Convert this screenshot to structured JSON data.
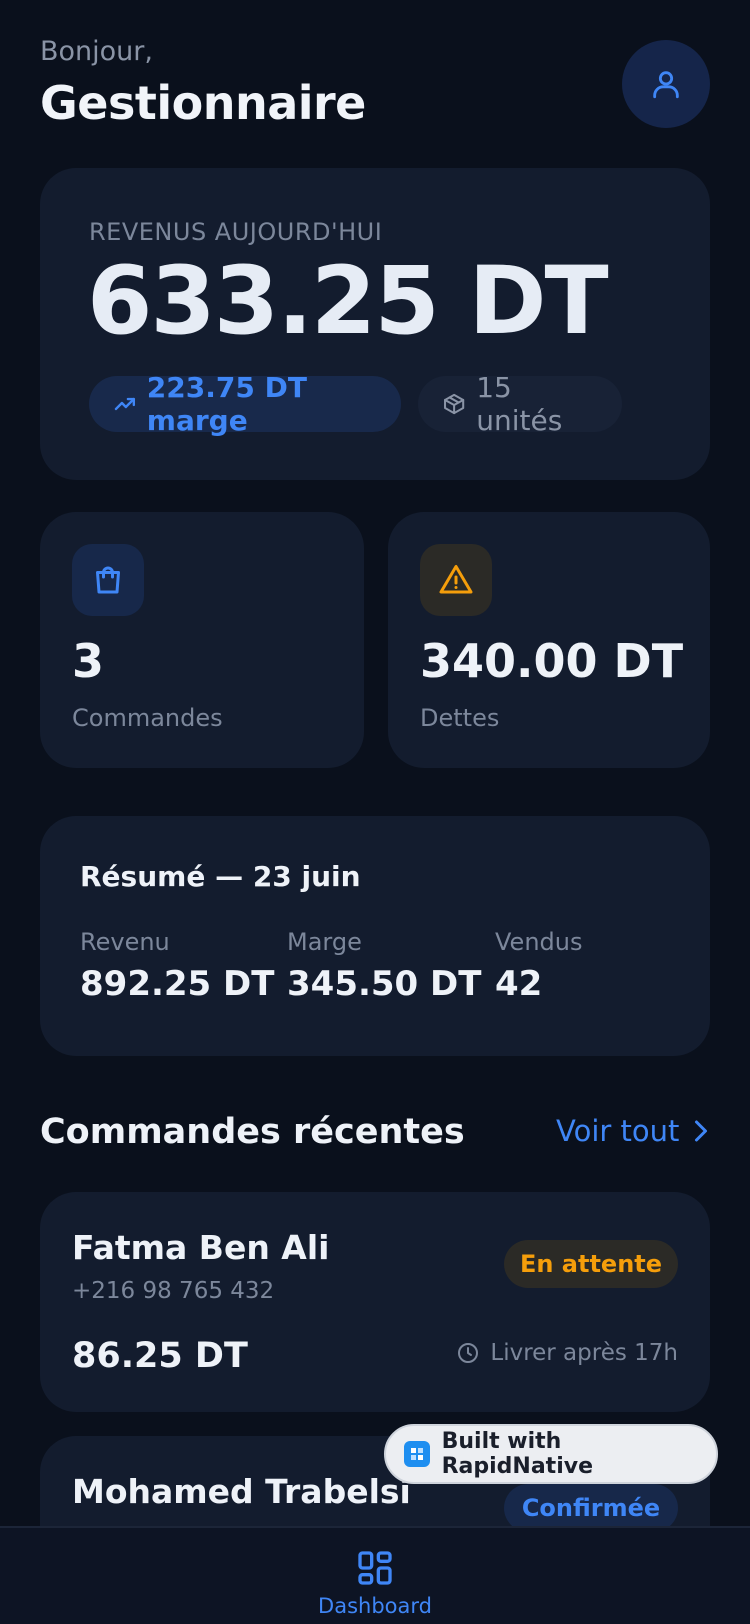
{
  "header": {
    "greeting": "Bonjour,",
    "name": "Gestionnaire",
    "avatar_icon": "user-icon"
  },
  "revenue": {
    "label": "REVENUS AUJOURD'HUI",
    "value": "633.25 DT",
    "margin": "223.75 DT marge",
    "margin_icon": "trending-up-icon",
    "units": "15 unités",
    "units_icon": "package-icon"
  },
  "stats": {
    "orders": {
      "value": "3",
      "label": "Commandes",
      "icon": "shopping-bag-icon"
    },
    "debts": {
      "value": "340.00 DT",
      "label": "Dettes",
      "icon": "alert-triangle-icon"
    }
  },
  "summary": {
    "title": "Résumé — 23 juin",
    "columns": [
      {
        "label": "Revenu",
        "value": "892.25 DT"
      },
      {
        "label": "Marge",
        "value": "345.50 DT"
      },
      {
        "label": "Vendus",
        "value": "42"
      }
    ]
  },
  "recent_orders": {
    "title": "Commandes récentes",
    "see_all": "Voir tout",
    "items": [
      {
        "name": "Fatma Ben Ali",
        "phone": "+216 98 765 432",
        "status": "En attente",
        "amount": "86.25 DT",
        "delivery": "Livrer après 17h"
      },
      {
        "name": "Mohamed Trabelsi",
        "status": "Confirmée"
      }
    ]
  },
  "built_with": "Built with RapidNative",
  "nav": {
    "dashboard_label": "Dashboard"
  },
  "colors": {
    "accent": "#3f86f6",
    "warning": "#f59e0b",
    "background": "#0a101c",
    "card": "#131c2e"
  }
}
